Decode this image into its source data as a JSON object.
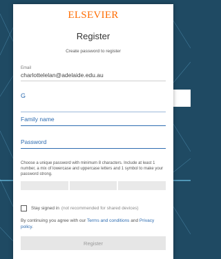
{
  "brand": {
    "name": "ELSEVIER"
  },
  "form": {
    "title": "Register",
    "subtitle": "Create password to register",
    "email": {
      "label": "Email",
      "value": "charlottelelan@adelaide.edu.au"
    },
    "given_name_partial": "G",
    "family_name": {
      "placeholder": "Family name"
    },
    "password": {
      "placeholder": "Password"
    },
    "password_hint": "Choose a unique password with minimum 8 characters. Include at least 1 number, a mix of lowercase and uppercase letters and 1 symbol to make your password strong.",
    "stay_signed_in": {
      "label": "Stay signed in",
      "note": "(not recommended for shared devices)"
    },
    "terms": {
      "prefix": "By continuing you agree with our ",
      "terms_link": "Terms and conditions",
      "and": " and ",
      "privacy_link": "Privacy policy",
      "suffix": "."
    },
    "register_button": "Register"
  },
  "colors": {
    "brand": "#ff6c00",
    "link": "#2c6bb0",
    "background": "#1f4a63"
  }
}
